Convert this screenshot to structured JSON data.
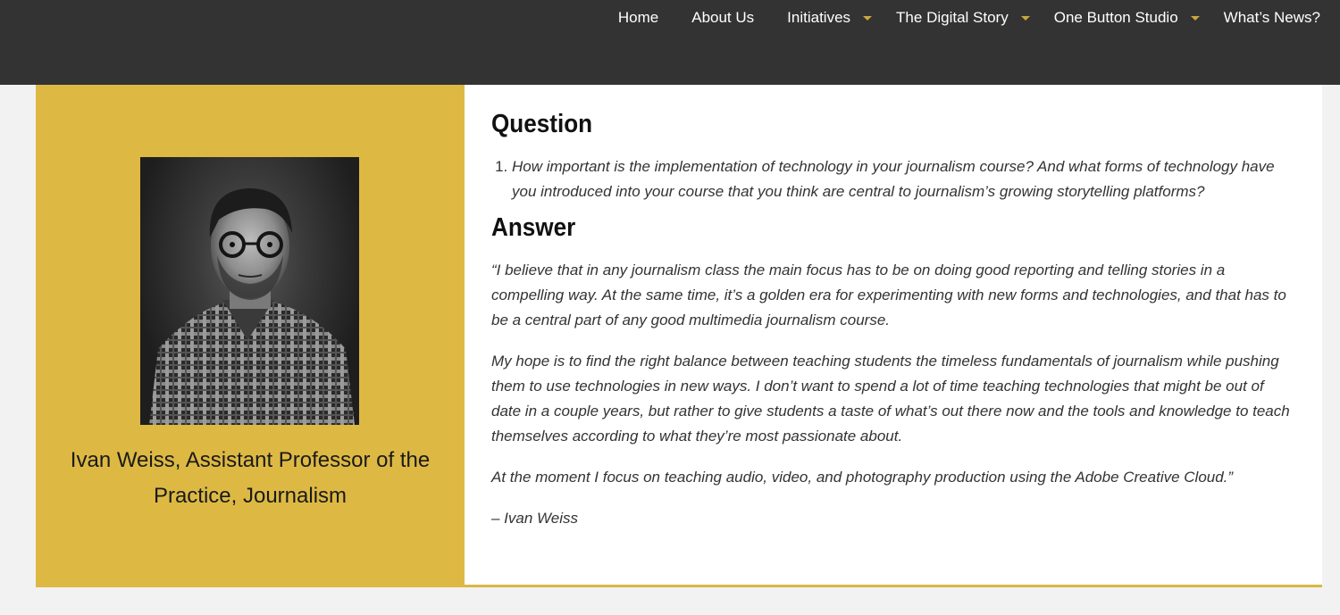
{
  "nav": {
    "items": [
      {
        "label": "Home",
        "dropdown": false
      },
      {
        "label": "About Us",
        "dropdown": false
      },
      {
        "label": "Initiatives",
        "dropdown": true
      },
      {
        "label": "The Digital Story",
        "dropdown": true
      },
      {
        "label": "One Button Studio",
        "dropdown": true
      },
      {
        "label": "What’s News?",
        "dropdown": false
      }
    ]
  },
  "profile": {
    "caption": "Ivan Weiss, Assistant Professor of the Practice, Journalism"
  },
  "question": {
    "heading": "Question",
    "items": [
      "How important is the implementation of technology in your journalism course? And what forms of technology have you introduced into your course that you think are central to journalism’s growing storytelling platforms?"
    ]
  },
  "answer": {
    "heading": "Answer",
    "paragraphs": [
      "“I believe that in any journalism class the main focus has to be on doing good reporting and telling stories in a compelling way. At the same time, it’s a golden era for experimenting with new forms and technologies, and that has to be a central part of any good multimedia journalism course.",
      "My hope is to find the right balance between teaching students the timeless fundamentals of journalism while pushing them to use technologies in new ways. I don’t want to spend a lot of time teaching technologies that might be out of date in a couple years, but rather to give students a taste of what’s out there now and the tools and knowledge to teach themselves according to what they’re most passionate about.",
      "At the moment I focus on teaching audio, video, and photography production using the Adobe Creative Cloud.”",
      "– Ivan Weiss"
    ]
  },
  "colors": {
    "topbar": "#333333",
    "accent": "#ddb944",
    "caret": "#c9a83a"
  }
}
